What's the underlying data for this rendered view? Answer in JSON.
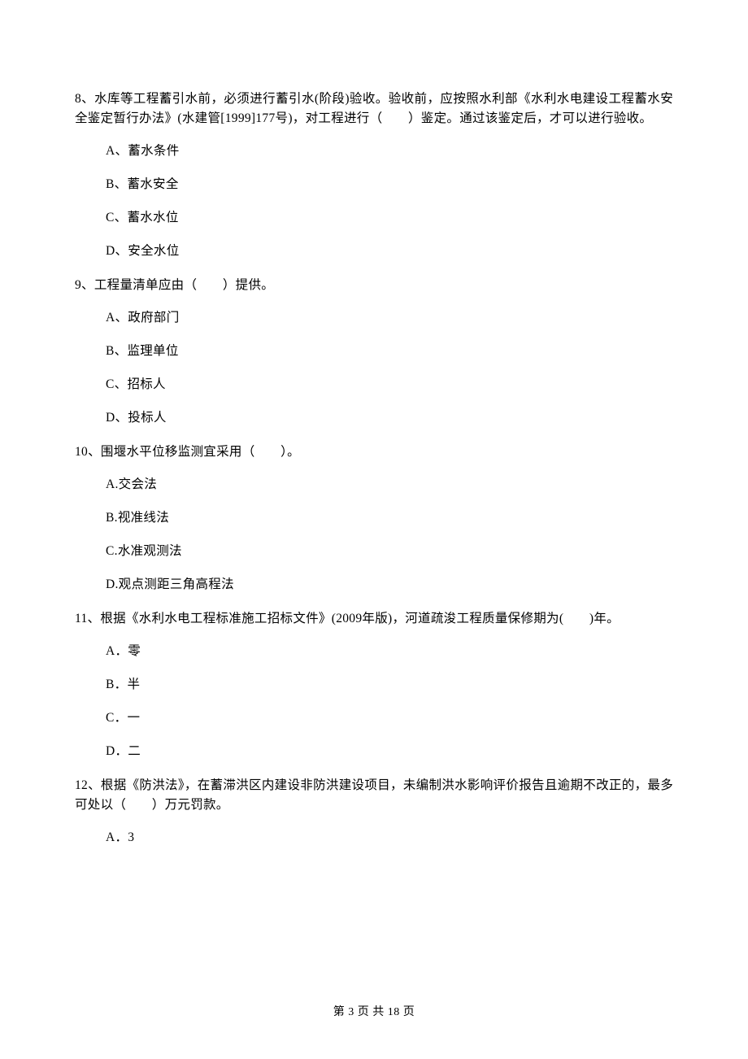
{
  "questions": [
    {
      "stem": "8、水库等工程蓄引水前，必须进行蓄引水(阶段)验收。验收前，应按照水利部《水利水电建设工程蓄水安全鉴定暂行办法》(水建管[1999]177号)，对工程进行（　　）鉴定。通过该鉴定后，才可以进行验收。",
      "options": [
        "A、蓄水条件",
        "B、蓄水安全",
        "C、蓄水水位",
        "D、安全水位"
      ]
    },
    {
      "stem": "9、工程量清单应由（　　）提供。",
      "options": [
        "A、政府部门",
        "B、监理单位",
        "C、招标人",
        "D、投标人"
      ]
    },
    {
      "stem": "10、围堰水平位移监测宜采用（　　）。",
      "options": [
        "A.交会法",
        "B.视准线法",
        "C.水准观测法",
        "D.观点测距三角高程法"
      ]
    },
    {
      "stem": "11、根据《水利水电工程标准施工招标文件》(2009年版)，河道疏浚工程质量保修期为(　　)年。",
      "options": [
        "A．零",
        "B．半",
        "C．一",
        "D．二"
      ]
    },
    {
      "stem": "12、根据《防洪法》，在蓄滞洪区内建设非防洪建设项目，未编制洪水影响评价报告且逾期不改正的，最多可处以（　　）万元罚款。",
      "options": [
        "A．3"
      ]
    }
  ],
  "footer": "第 3 页 共 18 页"
}
